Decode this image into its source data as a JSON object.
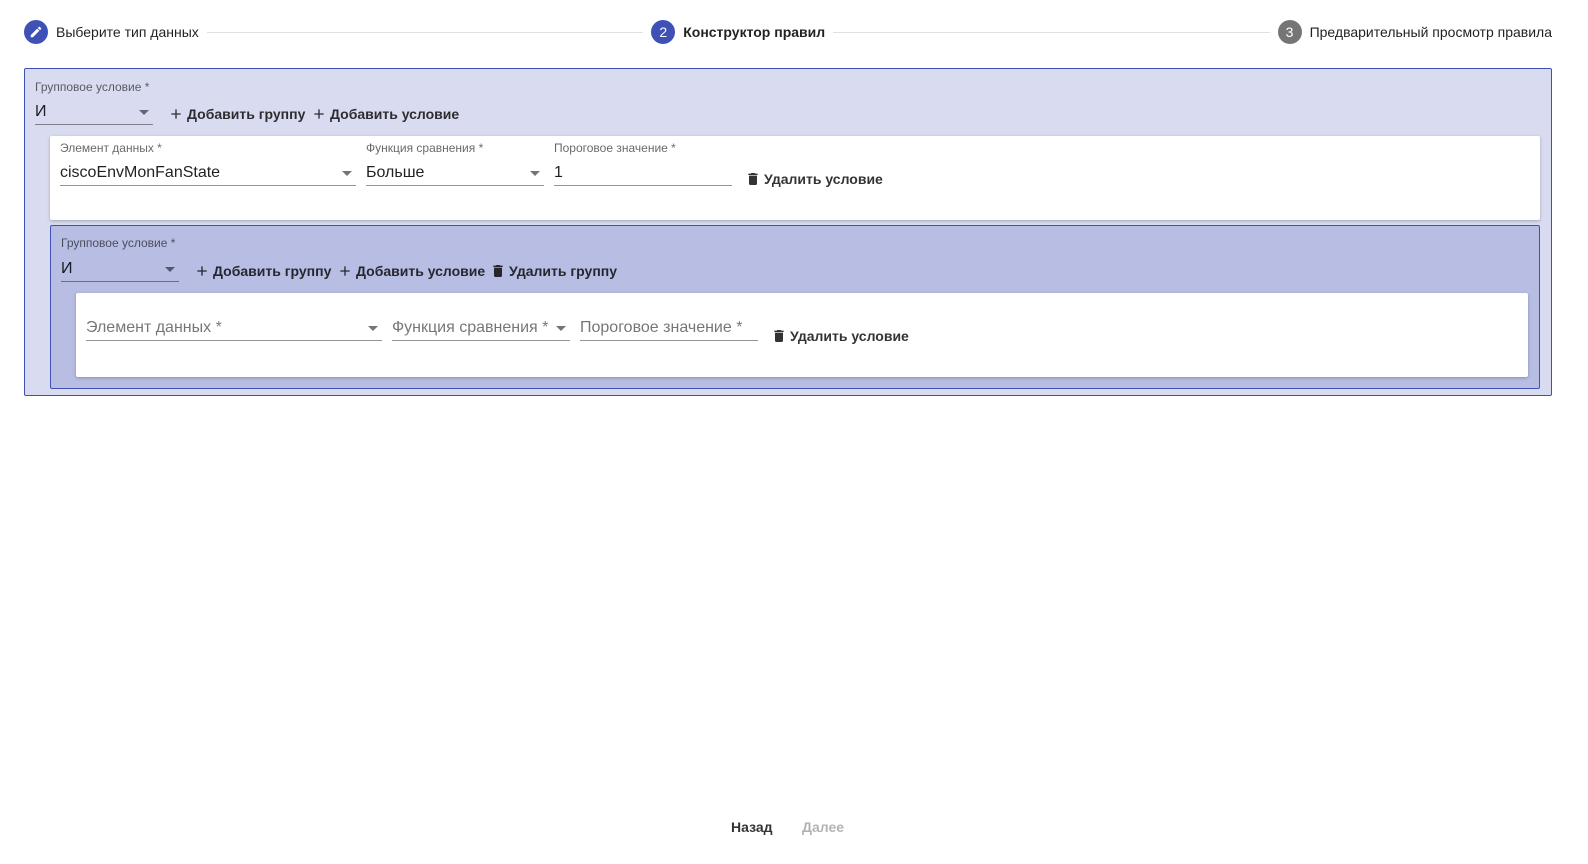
{
  "stepper": {
    "steps": [
      {
        "number": "",
        "icon": "pencil-icon",
        "label": "Выберите тип данных",
        "state": "done"
      },
      {
        "number": "2",
        "label": "Конструктор правил",
        "state": "active"
      },
      {
        "number": "3",
        "label": "Предварительный просмотр правила",
        "state": "pending"
      }
    ]
  },
  "outer_group": {
    "label": "Групповое условие *",
    "operator": "И",
    "add_group": "Добавить группу",
    "add_condition": "Добавить условие",
    "condition": {
      "data_element_label": "Элемент данных *",
      "data_element_value": "ciscoEnvMonFanState",
      "comparison_label": "Функция сравнения *",
      "comparison_value": "Больше",
      "threshold_label": "Пороговое значение *",
      "threshold_value": "1",
      "delete_condition": "Удалить условие"
    },
    "inner_group": {
      "label": "Групповое условие *",
      "operator": "И",
      "add_group": "Добавить группу",
      "add_condition": "Добавить условие",
      "delete_group": "Удалить группу",
      "condition": {
        "data_element_placeholder": "Элемент данных *",
        "comparison_placeholder": "Функция сравнения *",
        "threshold_placeholder": "Пороговое значение *",
        "delete_condition": "Удалить условие"
      }
    }
  },
  "footer": {
    "back": "Назад",
    "next": "Далее"
  },
  "colors": {
    "primary": "#3f51b5",
    "outer_group_bg": "#d9dbf0",
    "inner_group_bg": "#b8bde3"
  }
}
